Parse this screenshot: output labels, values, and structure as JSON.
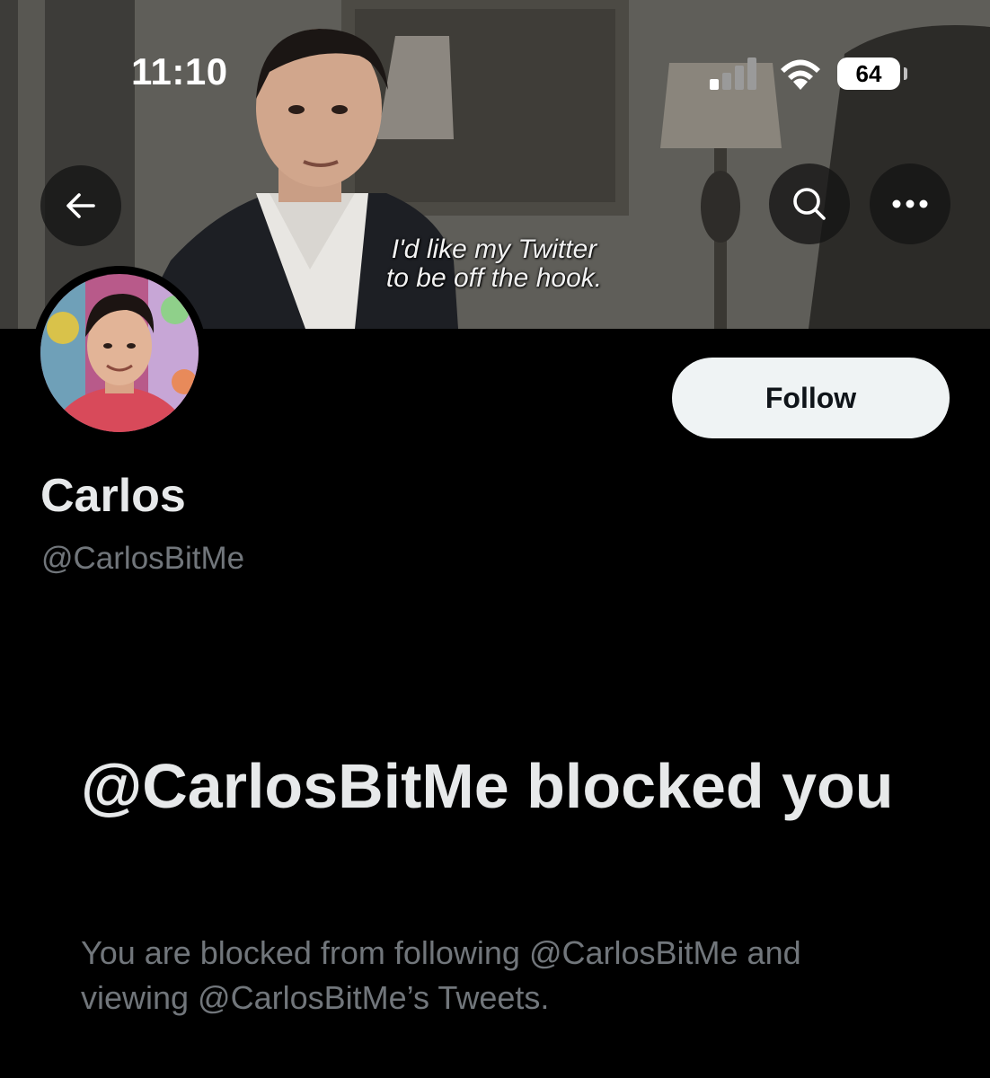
{
  "status_bar": {
    "time": "11:10",
    "battery": "64"
  },
  "banner": {
    "caption_line1": "I'd like my Twitter",
    "caption_line2": "to be off the hook."
  },
  "header": {
    "back_icon": "arrow-left-icon",
    "search_icon": "search-icon",
    "more_icon": "more-horizontal-icon"
  },
  "profile": {
    "display_name": "Carlos",
    "handle": "@CarlosBitMe",
    "follow_label": "Follow"
  },
  "blocked": {
    "title": "@CarlosBitMe blocked you",
    "description": "You are blocked from following @CarlosBitMe and viewing @CarlosBitMe’s Tweets."
  },
  "colors": {
    "background": "#000000",
    "primary_text": "#e7e9ea",
    "secondary_text": "#71767b",
    "follow_button_bg": "#eff3f4"
  }
}
